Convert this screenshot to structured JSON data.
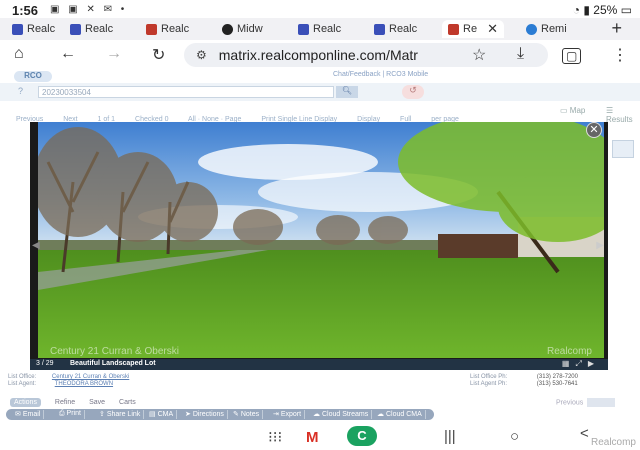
{
  "status": {
    "time": "1:56",
    "battery": "25%"
  },
  "tabs": [
    {
      "label": "Realc",
      "icon": "realcomp-icon",
      "color": "#3a4fb8"
    },
    {
      "label": "Realc",
      "icon": "realcomp-icon",
      "color": "#3a4fb8"
    },
    {
      "label": "Realc",
      "icon": "cube-icon",
      "color": "#c0392b"
    },
    {
      "label": "Midw",
      "icon": "globe-icon",
      "color": "#222"
    },
    {
      "label": "Realc",
      "icon": "realcomp-icon",
      "color": "#3a4fb8"
    },
    {
      "label": "Realc",
      "icon": "realcomp-icon",
      "color": "#3a4fb8"
    },
    {
      "label": "Re",
      "icon": "cube-icon",
      "color": "#c0392b",
      "active": true
    },
    {
      "label": "Remi",
      "icon": "chat-icon",
      "color": "#2b7cd3"
    }
  ],
  "toolbar": {
    "url": "matrix.realcomponline.com/Matr"
  },
  "site": {
    "logo": "RCO",
    "head_links": "Chat/Feedback | RCO3 Mobile",
    "search_value": "20230033504",
    "map_label": "Map",
    "results_label": "Results",
    "nav_items": [
      "Previous",
      "Next",
      "1 of 1",
      "Checked 0",
      "All · None · Page",
      "Print Single Line Display",
      "Display",
      "Full",
      "per page"
    ]
  },
  "viewer": {
    "counter": "3 / 29",
    "caption": "Beautiful Landscaped Lot",
    "watermark_left": "Century 21 Curran & Oberski",
    "watermark_right": "Realcomp"
  },
  "details": {
    "lot_office_label": "List Office:",
    "lot_office_value": "Century 21 Curran & Oberski",
    "lot_agent_label": "List Agent:",
    "lot_agent_value": "THEODORA BROWN",
    "lo_phone_label": "List Office Ph:",
    "lo_phone_value": "(313) 278-7200",
    "la_phone_label": "List Agent Ph:",
    "la_phone_value": "(313) 530-7641"
  },
  "action_tabs": [
    "Actions",
    "Refine",
    "Save",
    "Carts"
  ],
  "action_buttons": [
    "Email",
    "Print",
    "Share Link",
    "CMA",
    "Directions",
    "Notes",
    "Export",
    "Cloud Streams",
    "Cloud CMA"
  ],
  "pager": {
    "label": "Previous"
  },
  "brand": "Realcomp"
}
